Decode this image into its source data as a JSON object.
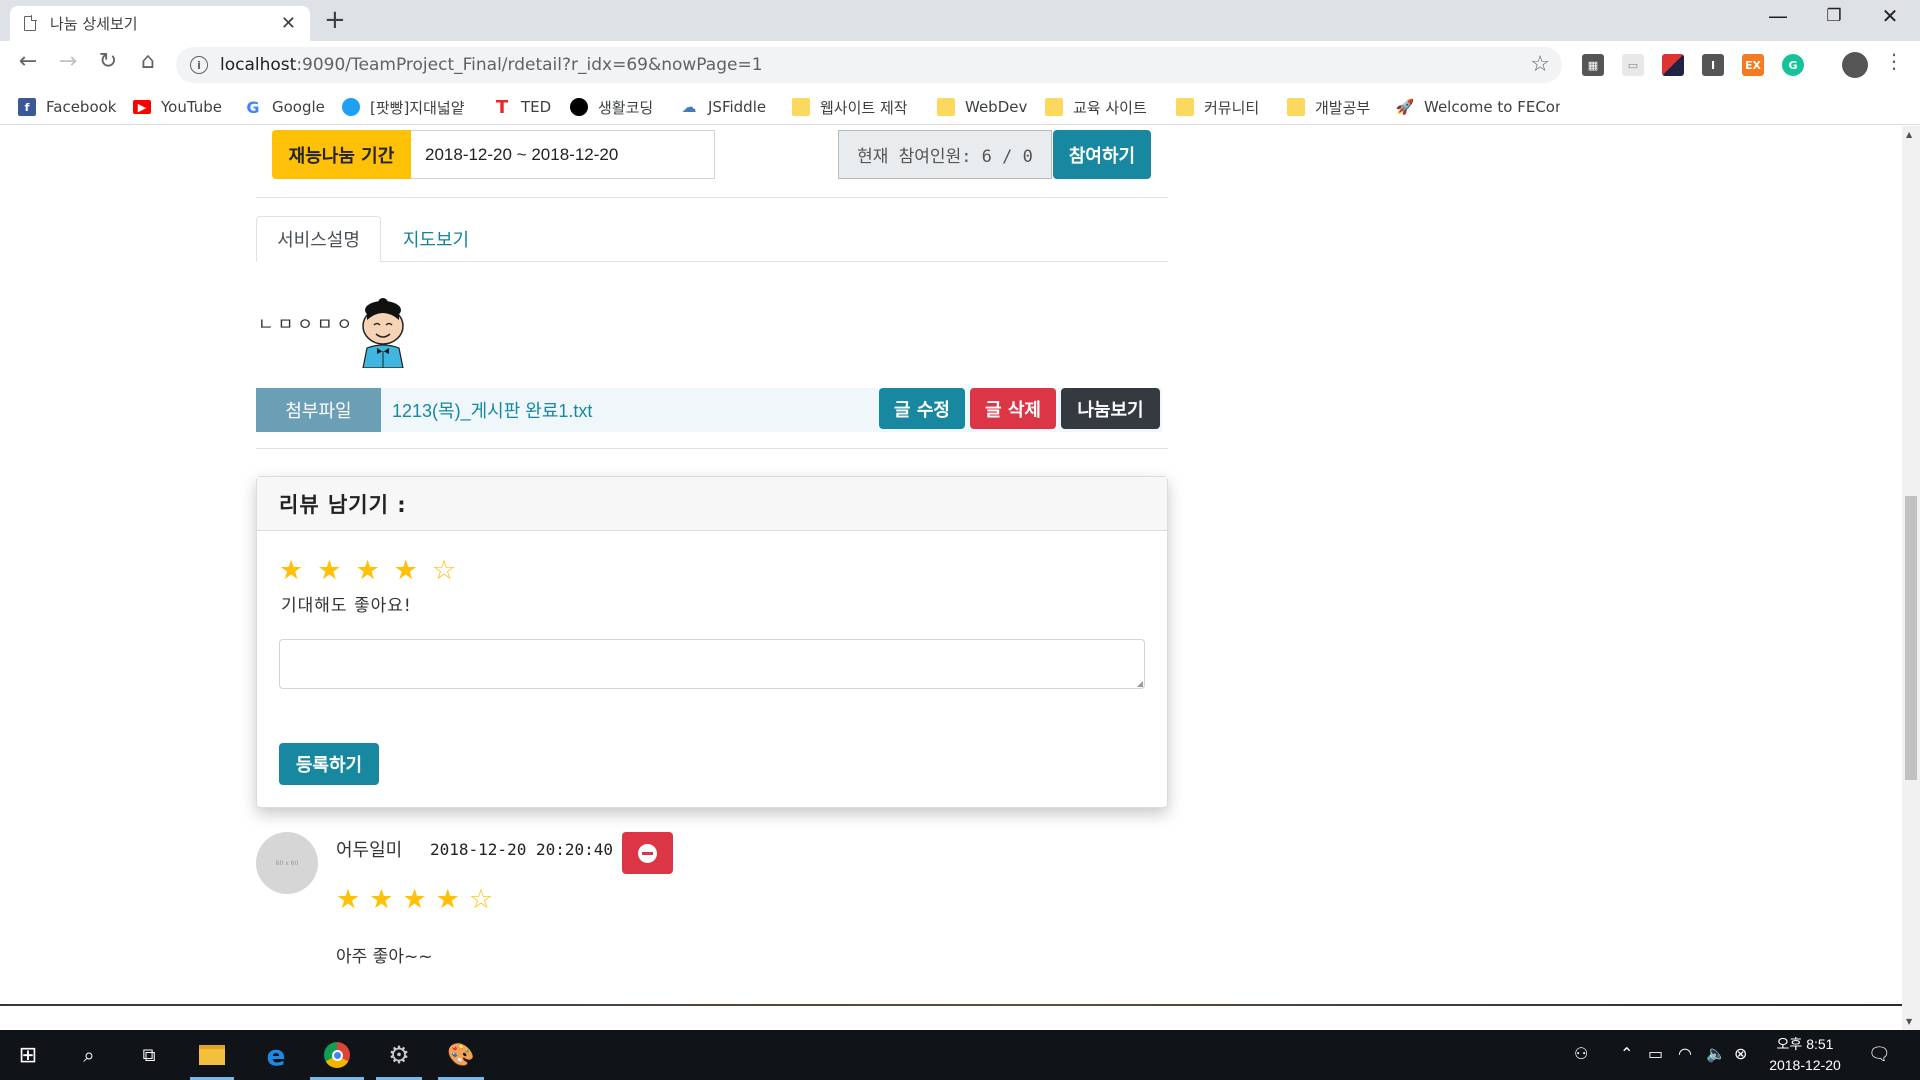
{
  "browser": {
    "tab_title": "나눔 상세보기",
    "url_host": "localhost",
    "url_rest": ":9090/TeamProject_Final/rdetail?r_idx=69&nowPage=1"
  },
  "bookmarks": [
    {
      "label": "Facebook",
      "icon": "facebook-icon",
      "color": "#3b5998"
    },
    {
      "label": "YouTube",
      "icon": "youtube-icon",
      "color": "#ff0000"
    },
    {
      "label": "Google",
      "icon": "google-icon",
      "color": "#4285f4"
    },
    {
      "label": "[팟빵]지대넓얕",
      "icon": "podbbang-icon",
      "color": "#1da1f2"
    },
    {
      "label": "TED",
      "icon": "ted-icon",
      "color": "#e62b1e"
    },
    {
      "label": "생활코딩",
      "icon": "opentutorials-icon",
      "color": "#000000"
    },
    {
      "label": "JSFiddle",
      "icon": "jsfiddle-icon",
      "color": "#4679bd"
    },
    {
      "label": "웹사이트 제작",
      "icon": "folder-icon",
      "color": "#fcd95e"
    },
    {
      "label": "WebDev",
      "icon": "folder-icon",
      "color": "#fcd95e"
    },
    {
      "label": "교육 사이트",
      "icon": "folder-icon",
      "color": "#fcd95e"
    },
    {
      "label": "커뮤니티",
      "icon": "folder-icon",
      "color": "#fcd95e"
    },
    {
      "label": "개발공부",
      "icon": "folder-icon",
      "color": "#fcd95e"
    },
    {
      "label": "Welcome to FEConf",
      "icon": "rocket-icon",
      "color": "#7b3fe4"
    }
  ],
  "detail": {
    "period_label": "재능나눔 기간",
    "period_value": "2018-12-20 ~ 2018-12-20",
    "participants_text": "현재 참여인원: 6 / 0",
    "join_button": "참여하기",
    "tabs": [
      "서비스설명",
      "지도보기"
    ],
    "content_text": "ㄴㅁㅇㅁㅇ",
    "attach_label": "첨부파일",
    "attach_file": "1213(목)_게시판 완료1.txt",
    "edit_button": "글 수정",
    "delete_button": "글 삭제",
    "list_button": "나눔보기"
  },
  "review_form": {
    "header": "리뷰 남기기 :",
    "rating": 4,
    "rating_max": 5,
    "rating_text": "기대해도 좋아요!",
    "textarea_value": "",
    "submit_button": "등록하기"
  },
  "comments": [
    {
      "author": "어두일미",
      "date": "2018-12-20 20:20:40",
      "rating": 4,
      "rating_max": 5,
      "text": "아주 좋아~~",
      "avatar_text": "60 x 60"
    }
  ],
  "taskbar": {
    "time": "오후 8:51",
    "date": "2018-12-20"
  },
  "colors": {
    "warning": "#ffc107",
    "info": "#17889f",
    "danger": "#dc3545",
    "dark": "#343a40",
    "star": "#ffc107"
  }
}
